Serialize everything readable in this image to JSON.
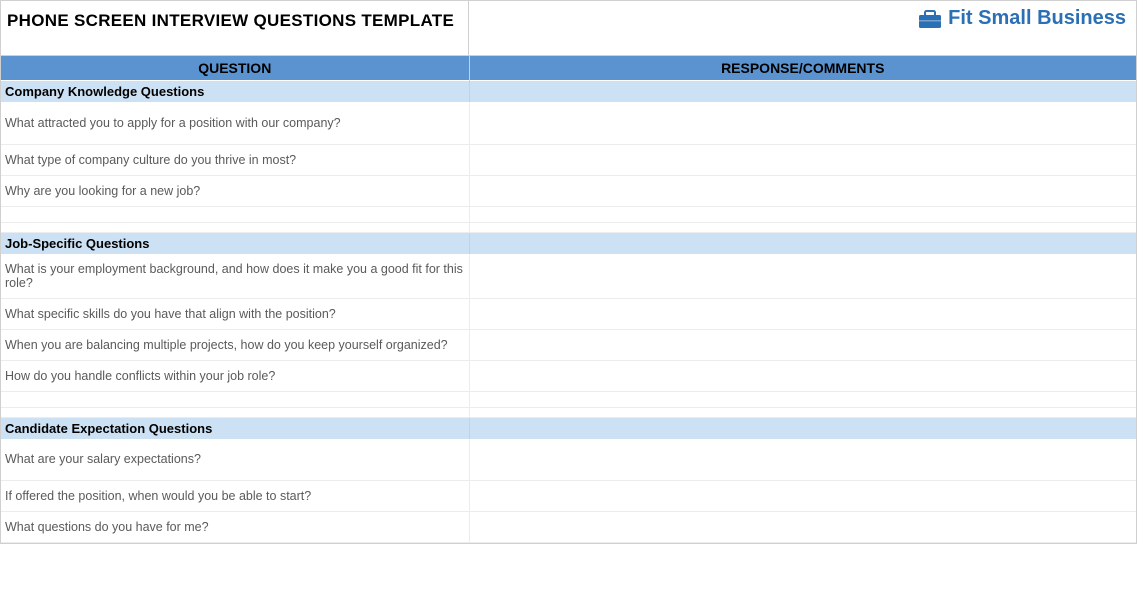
{
  "title": "PHONE SCREEN INTERVIEW QUESTIONS TEMPLATE",
  "logo_text": "Fit Small Business",
  "headers": {
    "question": "QUESTION",
    "response": "RESPONSE/COMMENTS"
  },
  "sections": [
    {
      "title": "Company Knowledge Questions",
      "questions": [
        "What attracted you to apply for a position with our company?",
        "What type of company culture do you thrive in most?",
        "Why are you looking for a new job?"
      ]
    },
    {
      "title": "Job-Specific Questions",
      "questions": [
        "What is your employment background, and how does it make you a good fit for this role?",
        "What specific skills do you have that align with the position?",
        "When you are balancing multiple projects, how do you keep yourself organized?",
        "How do you handle conflicts within your job role?"
      ]
    },
    {
      "title": "Candidate Expectation Questions",
      "questions": [
        "What are your salary expectations?",
        "If offered the position, when would you be able to start?",
        "What questions do you have for me?"
      ]
    }
  ]
}
